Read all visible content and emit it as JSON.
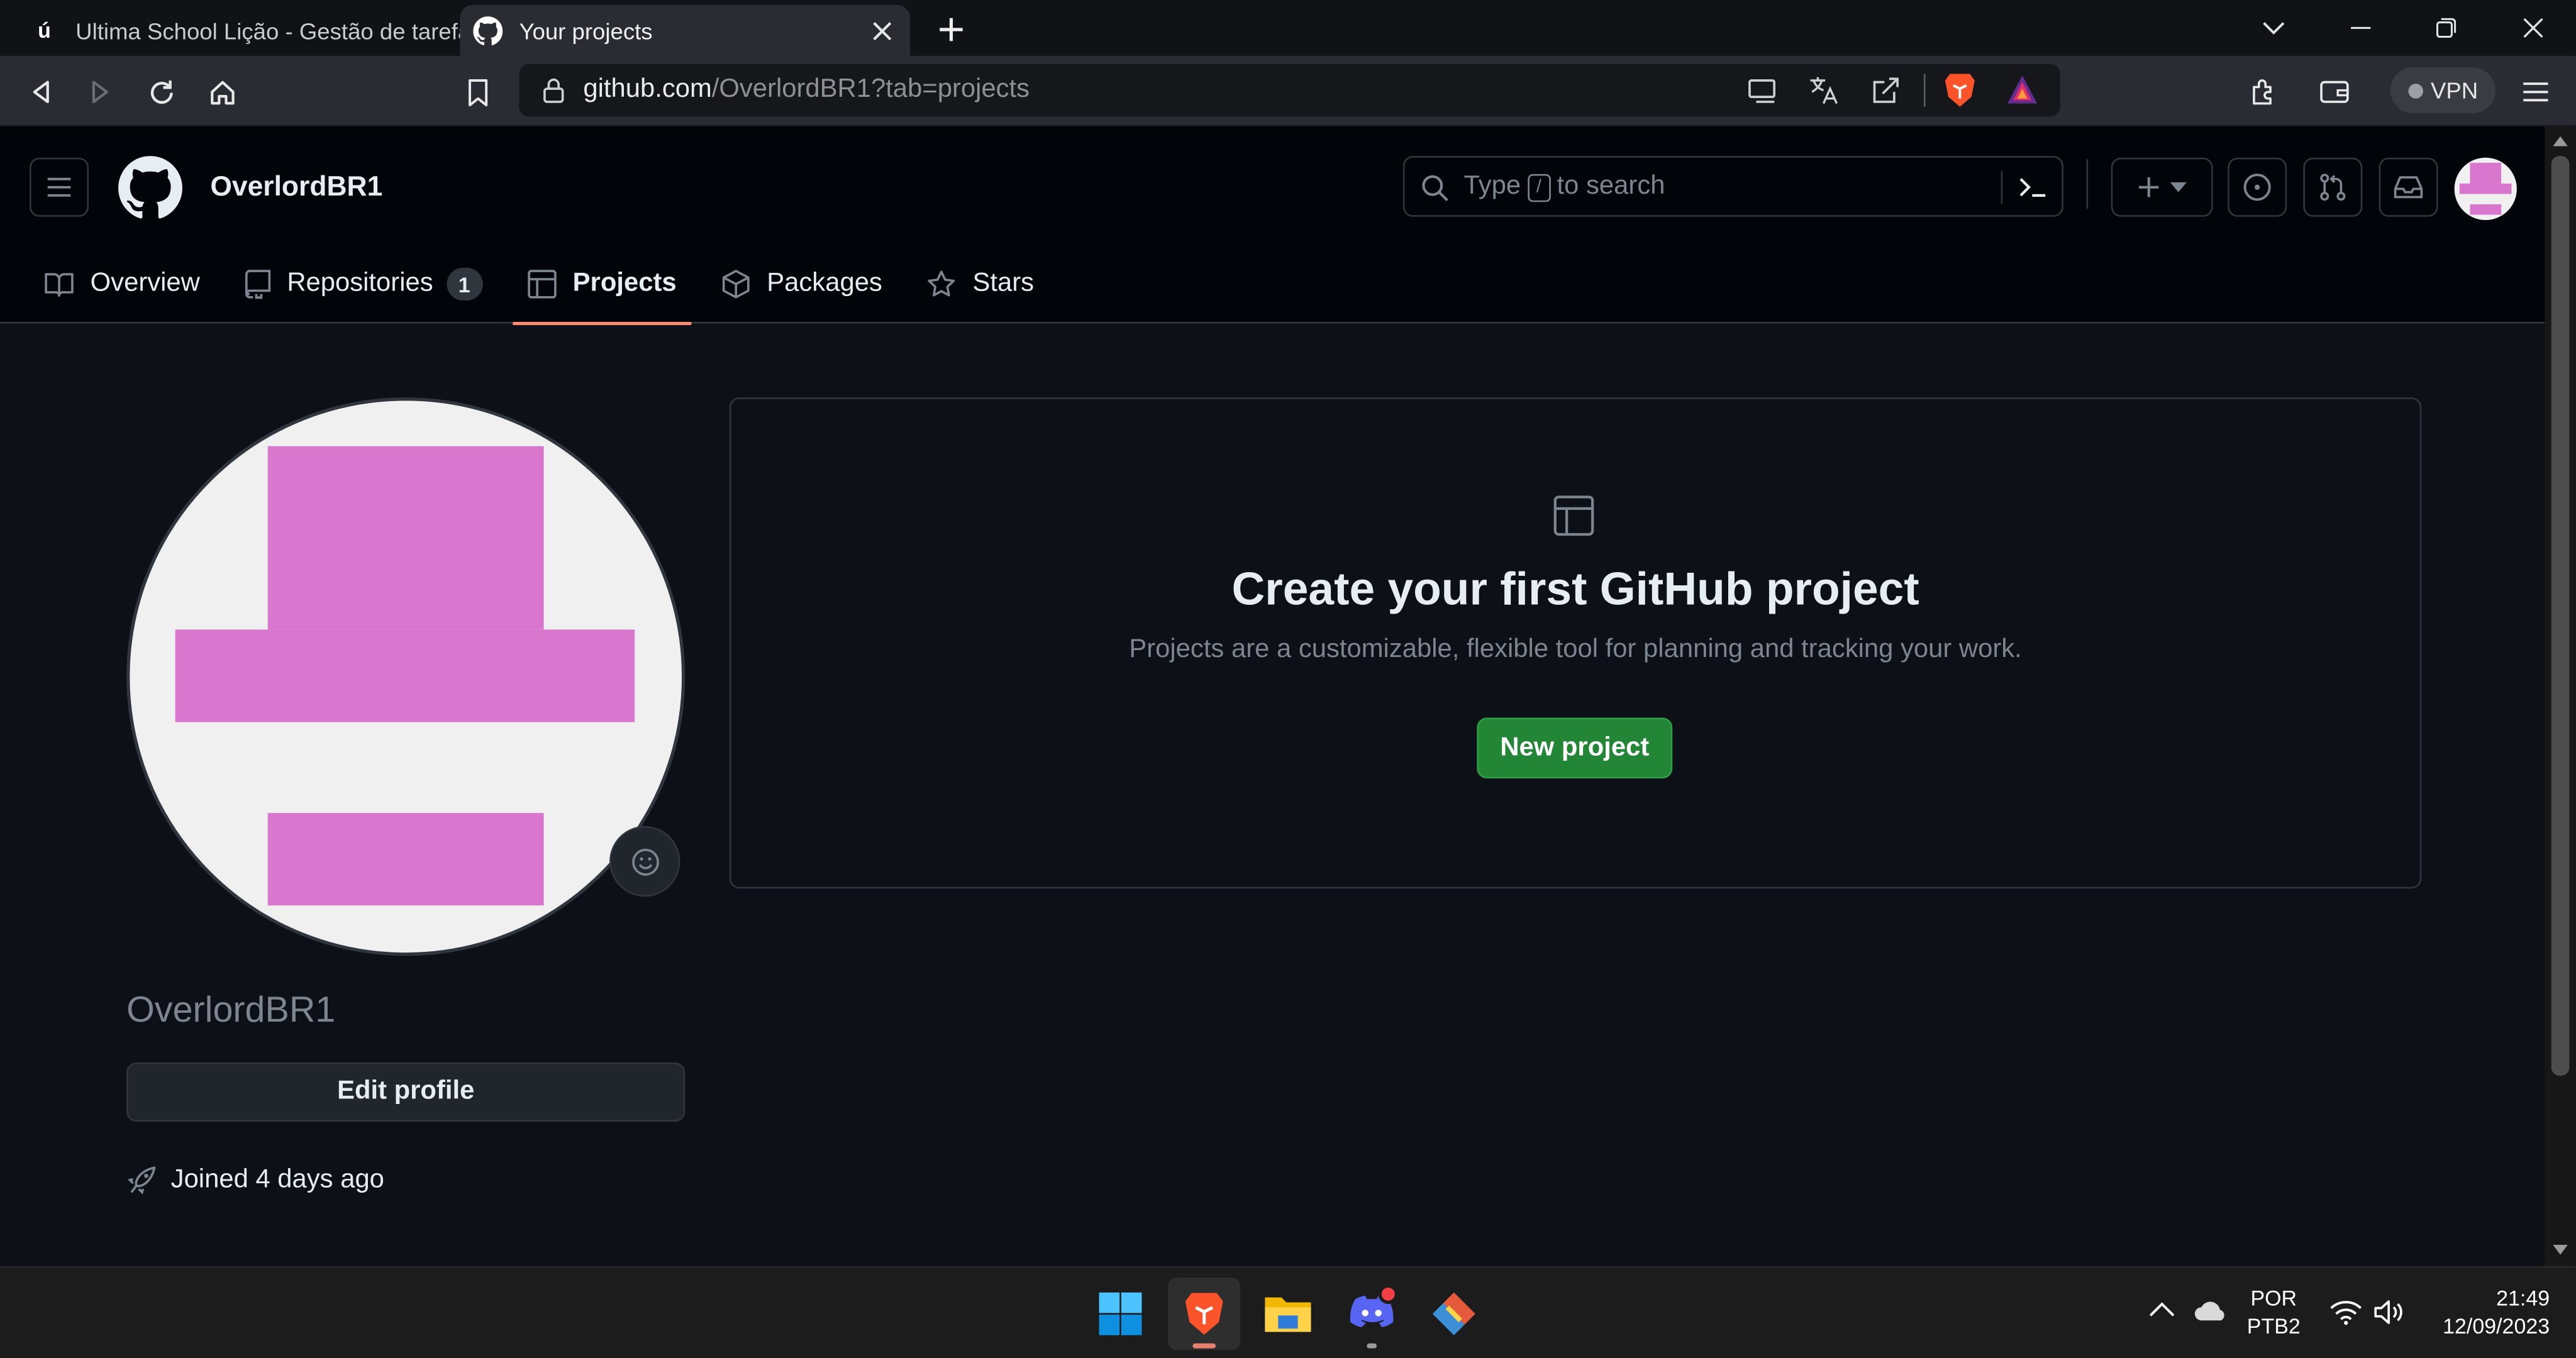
{
  "browser": {
    "tabs": [
      {
        "title": "Ultima School Lição - Gestão de tarefa",
        "favicon": "ú",
        "active": false
      },
      {
        "title": "Your projects",
        "active": true
      }
    ],
    "url_host": "github.com",
    "url_path": "/OverlordBR1?tab=projects",
    "vpn_label": "VPN"
  },
  "header": {
    "owner": "OverlordBR1",
    "search_prefix": "Type",
    "search_key": "/",
    "search_suffix": "to search"
  },
  "nav": {
    "tabs": [
      {
        "label": "Overview",
        "icon": "book-icon"
      },
      {
        "label": "Repositories",
        "icon": "repo-icon",
        "count": "1"
      },
      {
        "label": "Projects",
        "icon": "table-icon",
        "active": true
      },
      {
        "label": "Packages",
        "icon": "package-icon"
      },
      {
        "label": "Stars",
        "icon": "star-icon"
      }
    ]
  },
  "profile": {
    "username": "OverlordBR1",
    "edit_label": "Edit profile",
    "joined": "Joined 4 days ago"
  },
  "blankslate": {
    "title": "Create your first GitHub project",
    "description": "Projects are a customizable, flexible tool for planning and tracking your work.",
    "button": "New project"
  },
  "taskbar": {
    "lang_top": "POR",
    "lang_bottom": "PTB2",
    "time": "21:49",
    "date": "12/09/2023"
  },
  "colors": {
    "accent_tab_underline": "#fd8c73",
    "primary_button": "#238636",
    "avatar_identicon": "#d977cf",
    "page_background": "#0d1117"
  }
}
